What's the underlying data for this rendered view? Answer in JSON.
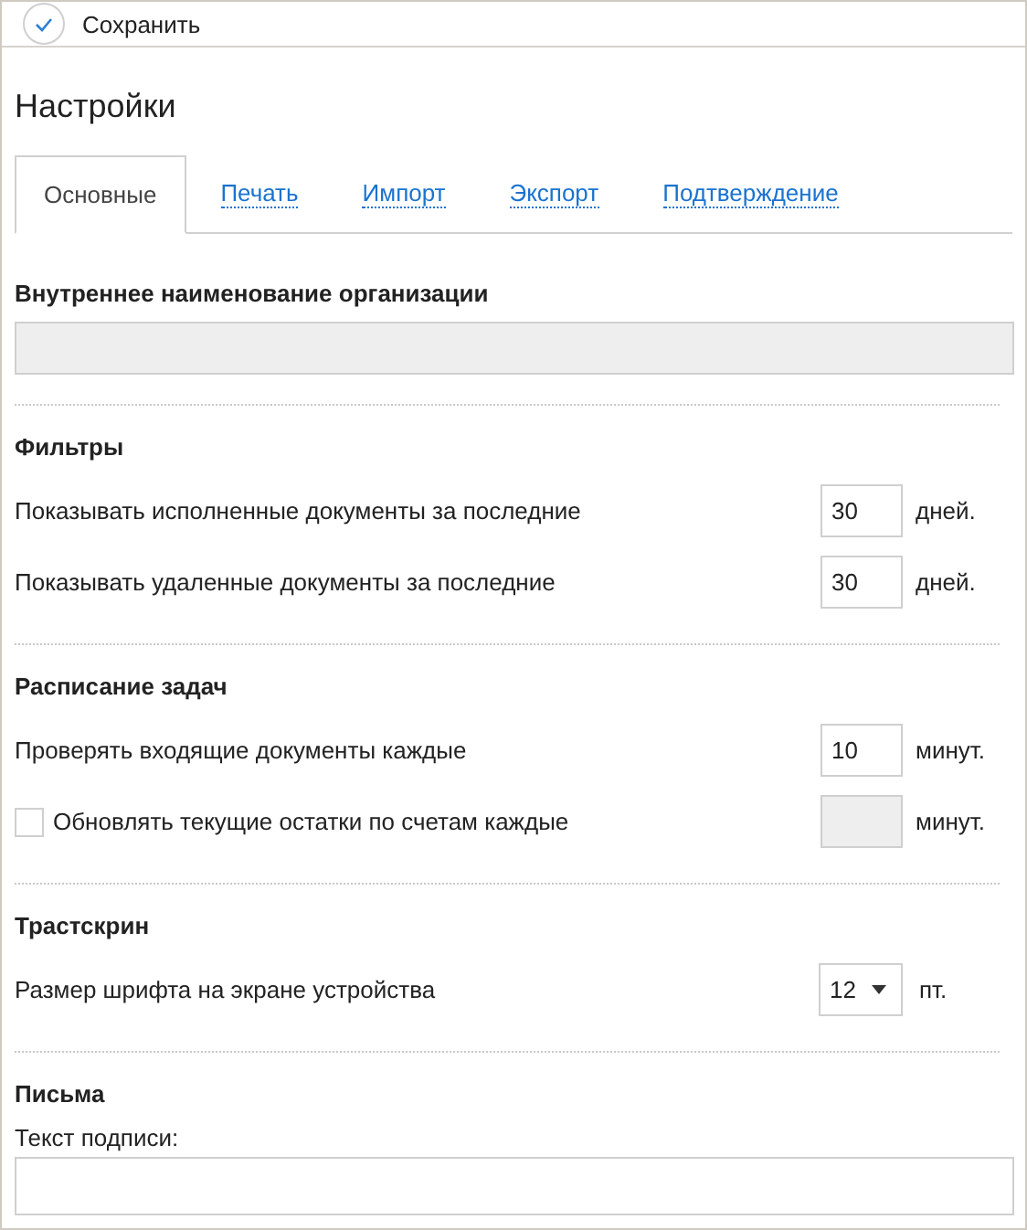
{
  "toolbar": {
    "save": "Сохранить"
  },
  "title": "Настройки",
  "tabs": [
    {
      "label": "Основные",
      "selected": true
    },
    {
      "label": "Печать",
      "selected": false
    },
    {
      "label": "Импорт",
      "selected": false
    },
    {
      "label": "Экспорт",
      "selected": false
    },
    {
      "label": "Подтверждение",
      "selected": false
    }
  ],
  "sections": [
    {
      "title": "Внутреннее наименование организации",
      "rows": [
        {
          "kind": "wide",
          "disabled": true
        }
      ]
    },
    {
      "title": "Фильтры",
      "rows": [
        {
          "kind": "number",
          "label": "Показывать исполненные документы за последние",
          "value": "30",
          "unit": "дней.",
          "disabled": false
        },
        {
          "kind": "number",
          "label": "Показывать удаленные документы за последние",
          "value": "30",
          "unit": "дней.",
          "disabled": false
        }
      ]
    },
    {
      "title": "Расписание задач",
      "rows": [
        {
          "kind": "number",
          "label": "Проверять входящие документы каждые",
          "value": "10",
          "unit": "минут.",
          "disabled": false
        },
        {
          "kind": "checkbox",
          "label": "Обновлять текущие остатки по счетам каждые",
          "checked": false,
          "unit": "минут.",
          "disabled": true
        }
      ]
    },
    {
      "title": "Трастскрин",
      "rows": [
        {
          "kind": "select",
          "label": "Размер шрифта на экране устройства",
          "value": "12",
          "unit": "пт."
        }
      ]
    },
    {
      "title": "Письма",
      "rows": [
        {
          "kind": "textarea",
          "label": "Текст подписи:",
          "disabled": false
        }
      ]
    }
  ]
}
